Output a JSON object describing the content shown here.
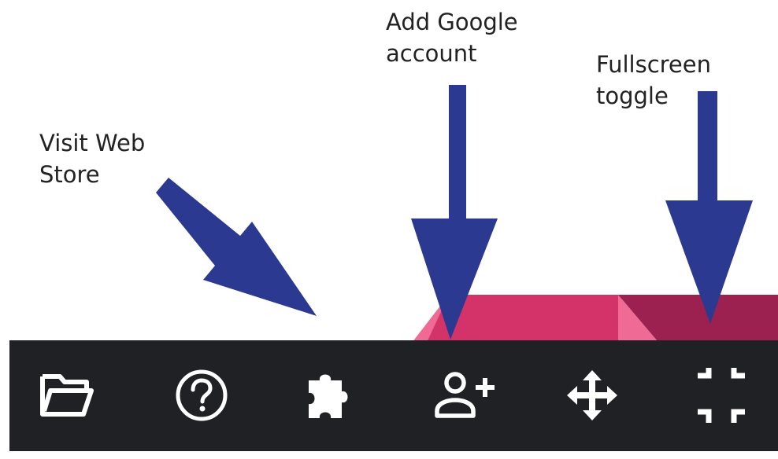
{
  "annotations": {
    "visit_web_store": "Visit Web\nStore",
    "add_google_account": "Add Google\naccount",
    "fullscreen_toggle": "Fullscreen\ntoggle"
  },
  "taskbar": {
    "buttons": [
      {
        "icon": "folder-icon"
      },
      {
        "icon": "help-icon"
      },
      {
        "icon": "puzzle-extension-icon"
      },
      {
        "icon": "add-person-icon"
      },
      {
        "icon": "move-arrows-icon"
      },
      {
        "icon": "exit-fullscreen-icon"
      }
    ]
  },
  "colors": {
    "taskbar_bg": "#202124",
    "icon": "#ffffff",
    "arrow": "#2b3990",
    "pink_light": "#e85a8a",
    "pink_mid": "#d4336a",
    "pink_dark": "#9c2150",
    "text": "#222222"
  }
}
